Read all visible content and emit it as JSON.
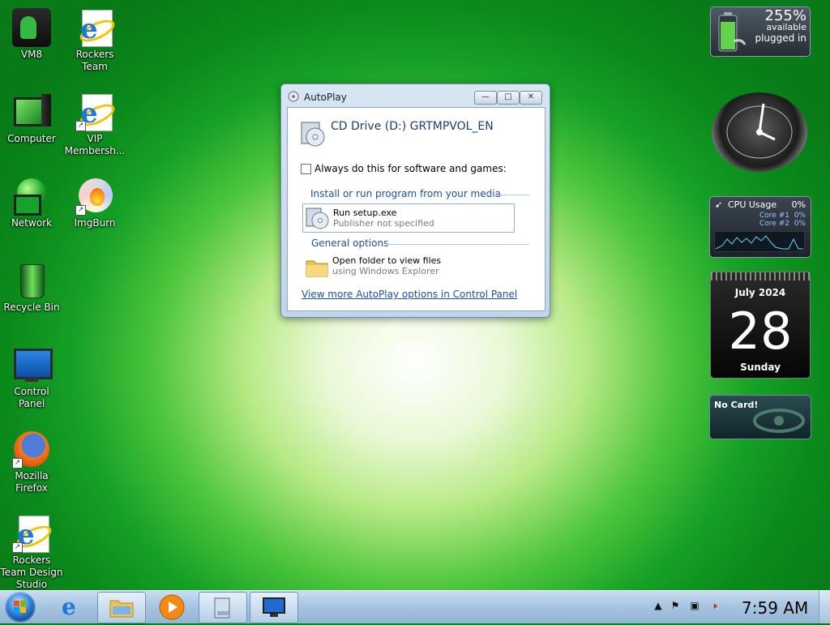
{
  "desktop_icons": [
    {
      "label": "VM8",
      "icon": "vm8-icon"
    },
    {
      "label": "Rockers Team",
      "icon": "internet-explorer-icon"
    },
    {
      "label": "Computer",
      "icon": "computer-icon"
    },
    {
      "label": "VIP Membersh...",
      "icon": "internet-explorer-icon"
    },
    {
      "label": "Network",
      "icon": "network-icon"
    },
    {
      "label": "ImgBurn",
      "icon": "imgburn-icon"
    },
    {
      "label": "Recycle Bin",
      "icon": "recycle-bin-icon"
    },
    {
      "label": "Control Panel",
      "icon": "control-panel-icon"
    },
    {
      "label": "Mozilla Firefox",
      "icon": "firefox-icon"
    },
    {
      "label": "Rockers Team Design Studio",
      "icon": "internet-explorer-icon"
    }
  ],
  "autoplay": {
    "title": "AutoPlay",
    "drive": "CD Drive (D:) GRTMPVOL_EN",
    "always_label": "Always do this for software and games:",
    "section_install": "Install or run program from your media",
    "run_title": "Run setup.exe",
    "run_sub": "Publisher not specified",
    "section_general": "General options",
    "open_title": "Open folder to view files",
    "open_sub": "using Windows Explorer",
    "link": "View more AutoPlay options in Control Panel",
    "buttons": {
      "minimize": "—",
      "maximize": "□",
      "close": "✕"
    }
  },
  "gadgets": {
    "battery": {
      "percent": "255%",
      "status": "available",
      "power": "plugged in"
    },
    "cpu": {
      "title": "CPU Usage",
      "total": "0%",
      "core1_label": "Core #1",
      "core1": "0%",
      "core2_label": "Core #2",
      "core2": "0%"
    },
    "calendar": {
      "month_year": "July 2024",
      "day": "28",
      "weekday": "Sunday"
    },
    "card": {
      "text": "No Card!"
    }
  },
  "taskbar": {
    "time": "7:59 AM",
    "items": [
      "internet-explorer-icon",
      "windows-explorer-icon",
      "media-player-icon",
      "disk-drive-icon",
      "monitor-icon"
    ]
  },
  "colors": {
    "accent": "#1f4ea8",
    "link": "#1a4fb0",
    "desktop_green": "#16a127"
  }
}
